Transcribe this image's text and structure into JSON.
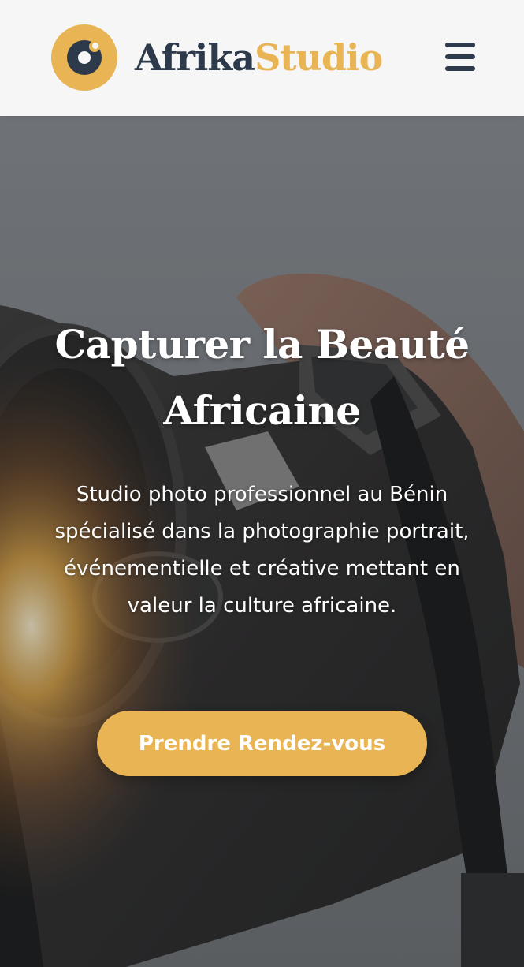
{
  "header": {
    "logo_text_primary": "Afrika",
    "logo_text_accent": "Studio",
    "logo_icon": "camera-lens-icon",
    "menu_icon": "hamburger-menu-icon"
  },
  "hero": {
    "title_line1": "Capturer la Beauté",
    "title_line2": "Africaine",
    "description": "Studio photo professionnel au Bénin spécialisé dans la photographie portrait, événementielle et créative mettant en valeur la culture africaine.",
    "cta_label": "Prendre Rendez-vous",
    "background": "camera-photo"
  },
  "colors": {
    "brand_dark": "#2d3a4b",
    "brand_accent": "#e8b454",
    "header_bg": "#f6f6f6"
  }
}
